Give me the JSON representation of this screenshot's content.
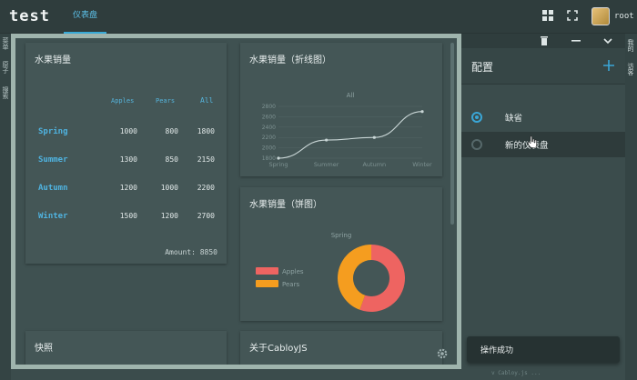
{
  "app": {
    "title": "test",
    "active_tab": "仪表盘"
  },
  "user": {
    "name": "root"
  },
  "side_tabs": [
    "菜单",
    "原子",
    "搜索"
  ],
  "right_tabs": [
    "我的",
    "访客"
  ],
  "cards": {
    "sales_table": {
      "title": "水果销量",
      "columns": [
        "Apples",
        "Pears",
        "All"
      ],
      "rows": [
        {
          "season": "Spring",
          "apples": "1000",
          "pears": "800",
          "all": "1800"
        },
        {
          "season": "Summer",
          "apples": "1300",
          "pears": "850",
          "all": "2150"
        },
        {
          "season": "Autumn",
          "apples": "1200",
          "pears": "1000",
          "all": "2200"
        },
        {
          "season": "Winter",
          "apples": "1500",
          "pears": "1200",
          "all": "2700"
        }
      ],
      "amount": "Amount: 8850"
    },
    "line_chart": {
      "title": "水果销量（折线图）"
    },
    "pie_chart": {
      "title": "水果销量（饼图）"
    },
    "snapshot": {
      "title": "快照"
    },
    "about": {
      "title": "关于CabloyJS"
    }
  },
  "chart_data": [
    {
      "type": "line",
      "title": "All",
      "categories": [
        "Spring",
        "Summer",
        "Autumn",
        "Winter"
      ],
      "series": [
        {
          "values": [
            1800,
            2150,
            2200,
            2700
          ]
        }
      ],
      "yticks": [
        "1800",
        "2000",
        "2200",
        "2400",
        "2600",
        "2800"
      ],
      "ylim": [
        1800,
        2800
      ],
      "grid": true,
      "color": "#c9d6d6"
    },
    {
      "type": "pie",
      "title": "Spring",
      "categories": [
        "Apples",
        "Pears"
      ],
      "values": [
        1000,
        800
      ],
      "colors": [
        "#ee6461",
        "#f59d1f"
      ],
      "legend": "left"
    }
  ],
  "config": {
    "title": "配置",
    "items": [
      {
        "label": "缺省",
        "selected": true
      },
      {
        "label": "新的仪表盘",
        "selected": false
      }
    ]
  },
  "toast": {
    "message": "操作成功"
  },
  "footer": "v Cabloy.js ..."
}
